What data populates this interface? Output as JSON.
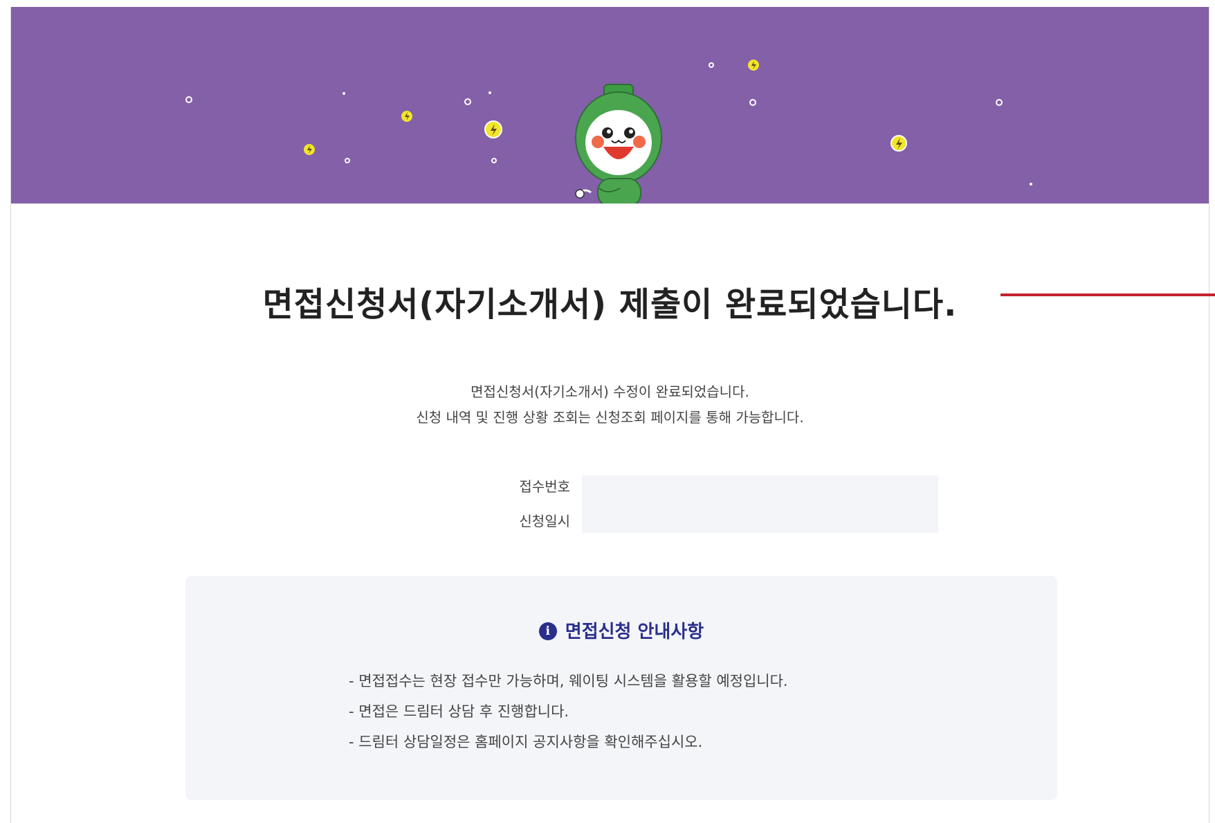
{
  "hero": {
    "background_color": "#8360a8",
    "mascot_icon": "green-lightbulb-mascot-icon",
    "decoration_icons": [
      "bolt-star-icon",
      "sparkle-dot-icon"
    ]
  },
  "main": {
    "title": "면접신청서(자기소개서) 제출이 완료되었습니다.",
    "message_line1": "면접신청서(자기소개서) 수정이 완료되었습니다.",
    "message_line2": "신청 내역 및 진행 상황 조회는 신청조회 페이지를 통해 가능합니다."
  },
  "receipt": {
    "number_label": "접수번호",
    "number_value": "",
    "date_label": "신청일시",
    "date_value": ""
  },
  "notice": {
    "icon": "info-icon",
    "icon_glyph": "i",
    "title": "면접신청 안내사항",
    "items": [
      "- 면접접수는 현장 접수만 가능하며, 웨이팅 시스템을 활용할 예정입니다.",
      "- 면접은 드림터 상담 후 진행합니다.",
      "- 드림터 상담일정은 홈페이지 공지사항을 확인해주십시오."
    ]
  },
  "colors": {
    "accent": "#2a2f8c",
    "annotation": "#c8202f",
    "panel": "#f4f5f9"
  }
}
